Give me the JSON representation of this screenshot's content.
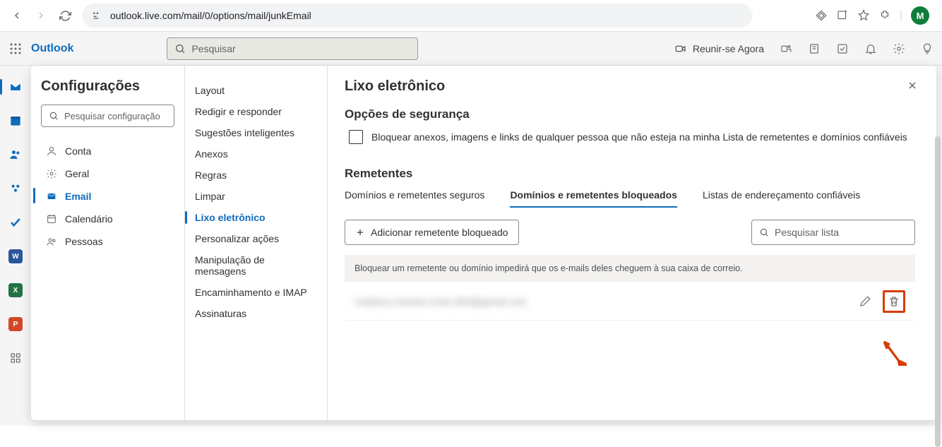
{
  "browser": {
    "url": "outlook.live.com/mail/0/options/mail/junkEmail",
    "profile_initial": "M"
  },
  "header": {
    "app_name": "Outlook",
    "search_placeholder": "Pesquisar",
    "meet_now": "Reunir-se Agora"
  },
  "settings": {
    "title": "Configurações",
    "search_placeholder": "Pesquisar configuração",
    "nav": {
      "account": "Conta",
      "general": "Geral",
      "email": "Email",
      "calendar": "Calendário",
      "people": "Pessoas"
    },
    "sub": {
      "layout": "Layout",
      "compose": "Redigir e responder",
      "suggest": "Sugestões inteligentes",
      "attach": "Anexos",
      "rules": "Regras",
      "sweep": "Limpar",
      "junk": "Lixo eletrônico",
      "custom": "Personalizar ações",
      "handling": "Manipulação de mensagens",
      "forward": "Encaminhamento e IMAP",
      "sig": "Assinaturas"
    }
  },
  "content": {
    "page_title": "Lixo eletrônico",
    "security_title": "Opções de segurança",
    "block_attach_label": "Bloquear anexos, imagens e links de qualquer pessoa que não esteja na minha Lista de remetentes e domínios confiáveis",
    "senders_title": "Remetentes",
    "tabs": {
      "safe": "Domínios e remetentes seguros",
      "blocked": "Domínios e remetentes bloqueados",
      "lists": "Listas de endereçamento confiáveis"
    },
    "add_blocked": "Adicionar remetente bloqueado",
    "search_list_placeholder": "Pesquisar lista",
    "info_text": "Bloquear um remetente ou domínio impedirá que os e-mails deles cheguem à sua caixa de correio.",
    "blocked_entry": "matheus.hansen.moto.904@gmail.com"
  }
}
